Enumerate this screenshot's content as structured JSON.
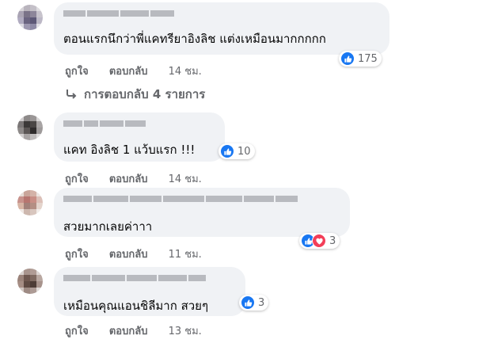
{
  "comments": [
    {
      "text": "ตอนแรกนึกว่าพี่แคทรียาอิงลิช แต่งเหมือนมากกกกก",
      "reaction_count": "175",
      "like_label": "ถูกใจ",
      "reply_label": "ตอบกลับ",
      "time": "14 ชม."
    },
    {
      "text": "แคท อิงลิช 1 แว้บแรก !!!",
      "reaction_count": "10",
      "like_label": "ถูกใจ",
      "reply_label": "ตอบกลับ",
      "time": "14 ชม."
    },
    {
      "text": "สวยมากเลยค่าาา",
      "reaction_count": "3",
      "like_label": "ถูกใจ",
      "reply_label": "ตอบกลับ",
      "time": "11 ชม."
    },
    {
      "text": "เหมือนคุณแอนชิลีมาก สวยๆ",
      "reaction_count": "3",
      "like_label": "ถูกใจ",
      "reply_label": "ตอบกลับ",
      "time": "13 ชม."
    }
  ],
  "view_replies_label": "การตอบกลับ 4 รายการ",
  "icons": {
    "like": "thumbs-up-icon",
    "love": "heart-icon",
    "reply_arrow": "reply-arrow-icon"
  },
  "colors": {
    "like_blue": "#1877f2",
    "love_red": "#f33e58",
    "bubble_bg": "#f0f2f5",
    "meta_gray": "#65676b"
  }
}
